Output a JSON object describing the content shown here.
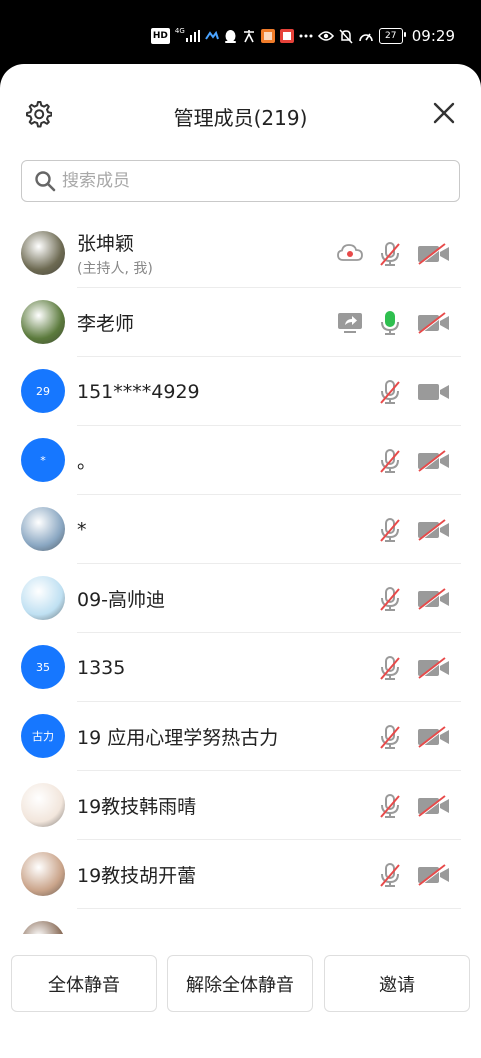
{
  "status_bar": {
    "time": "09:29",
    "battery": "27",
    "hd_label": "HD",
    "signal_label": "4G",
    "icons": [
      "hd-icon",
      "signal-icon",
      "data-icon",
      "qq-icon",
      "translate-icon",
      "app-icon",
      "app-icon",
      "more-icon",
      "eye-icon",
      "mute-bell-icon",
      "speed-icon",
      "battery-icon"
    ]
  },
  "header": {
    "title": "管理成员(219)"
  },
  "search": {
    "placeholder": "搜索成员"
  },
  "members": [
    {
      "name": "张坤颖",
      "sub": "(主持人, 我)",
      "avatar_type": "photo",
      "avatar_text": "",
      "extra_icon": "cloud-record-icon",
      "mic": "muted",
      "camera": "off"
    },
    {
      "name": "李老师",
      "sub": "",
      "avatar_type": "photo",
      "avatar_text": "",
      "extra_icon": "screen-share-icon",
      "mic": "active",
      "camera": "off"
    },
    {
      "name": "151****4929",
      "sub": "",
      "avatar_type": "blue",
      "avatar_text": "29",
      "extra_icon": "",
      "mic": "muted",
      "camera": "on"
    },
    {
      "name": "。",
      "sub": "",
      "avatar_type": "blue",
      "avatar_text": "*",
      "extra_icon": "",
      "mic": "muted",
      "camera": "off"
    },
    {
      "name": "*",
      "sub": "",
      "avatar_type": "photo",
      "avatar_text": "",
      "extra_icon": "",
      "mic": "muted",
      "camera": "off"
    },
    {
      "name": "09-高帅迪",
      "sub": "",
      "avatar_type": "photo",
      "avatar_text": "",
      "extra_icon": "",
      "mic": "muted",
      "camera": "off"
    },
    {
      "name": "1335",
      "sub": "",
      "avatar_type": "blue",
      "avatar_text": "35",
      "extra_icon": "",
      "mic": "muted",
      "camera": "off"
    },
    {
      "name": "19 应用心理学努热古力",
      "sub": "",
      "avatar_type": "blue",
      "avatar_text": "古力",
      "extra_icon": "",
      "mic": "muted",
      "camera": "off"
    },
    {
      "name": "19教技韩雨晴",
      "sub": "",
      "avatar_type": "photo",
      "avatar_text": "",
      "extra_icon": "",
      "mic": "muted",
      "camera": "off"
    },
    {
      "name": "19教技胡开蕾",
      "sub": "",
      "avatar_type": "photo",
      "avatar_text": "",
      "extra_icon": "",
      "mic": "muted",
      "camera": "off"
    }
  ],
  "footer": {
    "mute_all": "全体静音",
    "unmute_all": "解除全体静音",
    "invite": "邀请"
  },
  "colors": {
    "accent": "#1677ff",
    "muted_red": "#e84a4a",
    "icon_gray": "#9a9a9a",
    "mic_active": "#2fbf4f"
  }
}
